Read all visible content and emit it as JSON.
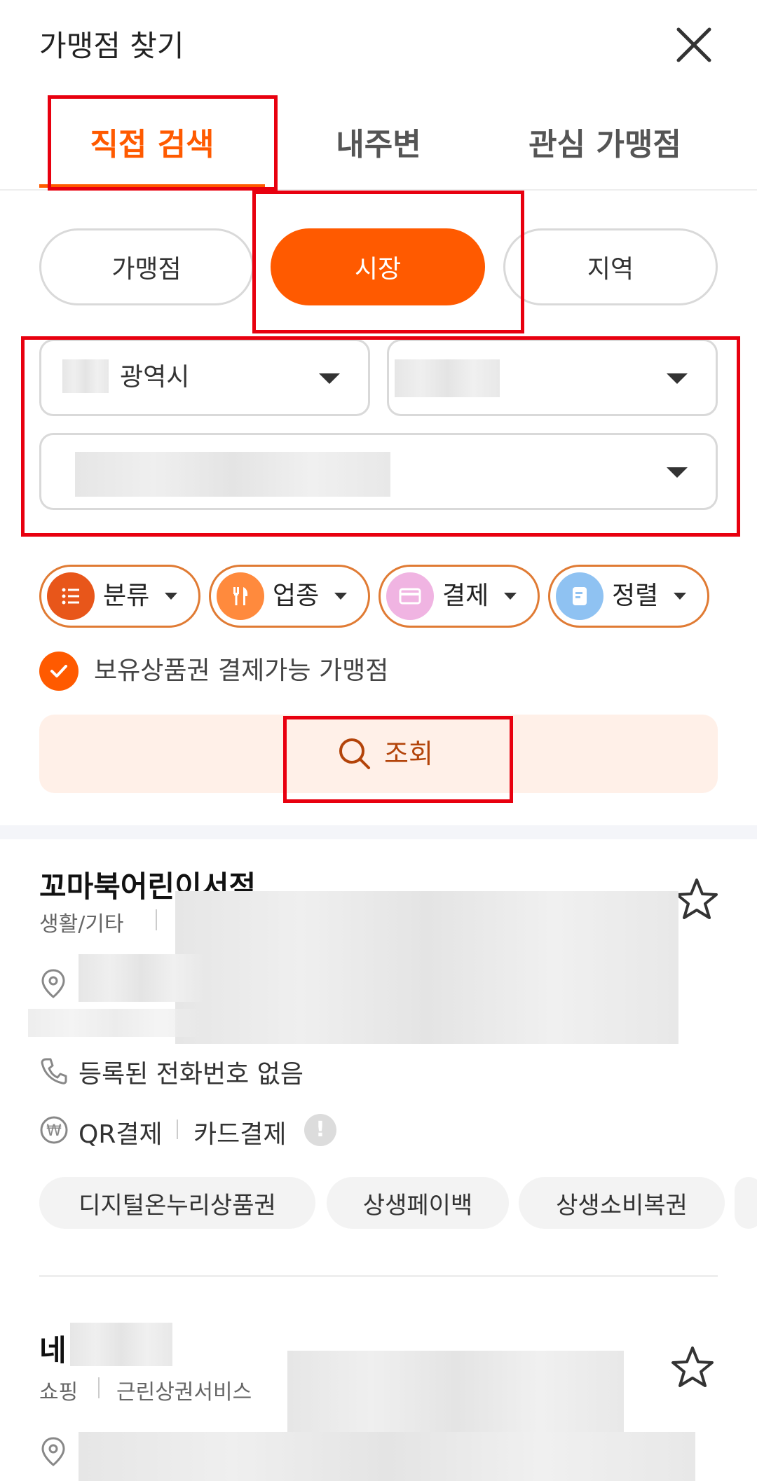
{
  "header": {
    "title": "가맹점 찾기"
  },
  "tabs": [
    {
      "label": "직접 검색",
      "active": true
    },
    {
      "label": "내주변",
      "active": false
    },
    {
      "label": "관심 가맹점",
      "active": false
    }
  ],
  "segments": [
    {
      "label": "가맹점",
      "active": false
    },
    {
      "label": "시장",
      "active": true
    },
    {
      "label": "지역",
      "active": false
    }
  ],
  "selects": {
    "city": "광역시",
    "district": "",
    "market": ""
  },
  "filters": [
    {
      "label": "분류",
      "icon": "list-icon",
      "icon_bg": "#e8561a"
    },
    {
      "label": "업종",
      "icon": "fork-knife-icon",
      "icon_bg": "#ff8a3d"
    },
    {
      "label": "결제",
      "icon": "card-icon",
      "icon_bg": "#f0b4e2"
    },
    {
      "label": "정렬",
      "icon": "document-icon",
      "icon_bg": "#8fc2f2"
    }
  ],
  "checkbox": {
    "label": "보유상품권 결제가능 가맹점",
    "checked": true
  },
  "search_button": {
    "label": "조회"
  },
  "stores": [
    {
      "name": "꼬마북어린이서점",
      "category": "생활/기타",
      "phone": "등록된 전화번호 없음",
      "payments": [
        "QR결제",
        "카드결제"
      ],
      "tags": [
        "디지털온누리상품권",
        "상생페이백",
        "상생소비복권"
      ]
    },
    {
      "name": "네",
      "category": "쇼핑",
      "subcategory": "근린상권서비스"
    }
  ],
  "colors": {
    "accent": "#ff5a00",
    "annotation": "#e8000f"
  }
}
